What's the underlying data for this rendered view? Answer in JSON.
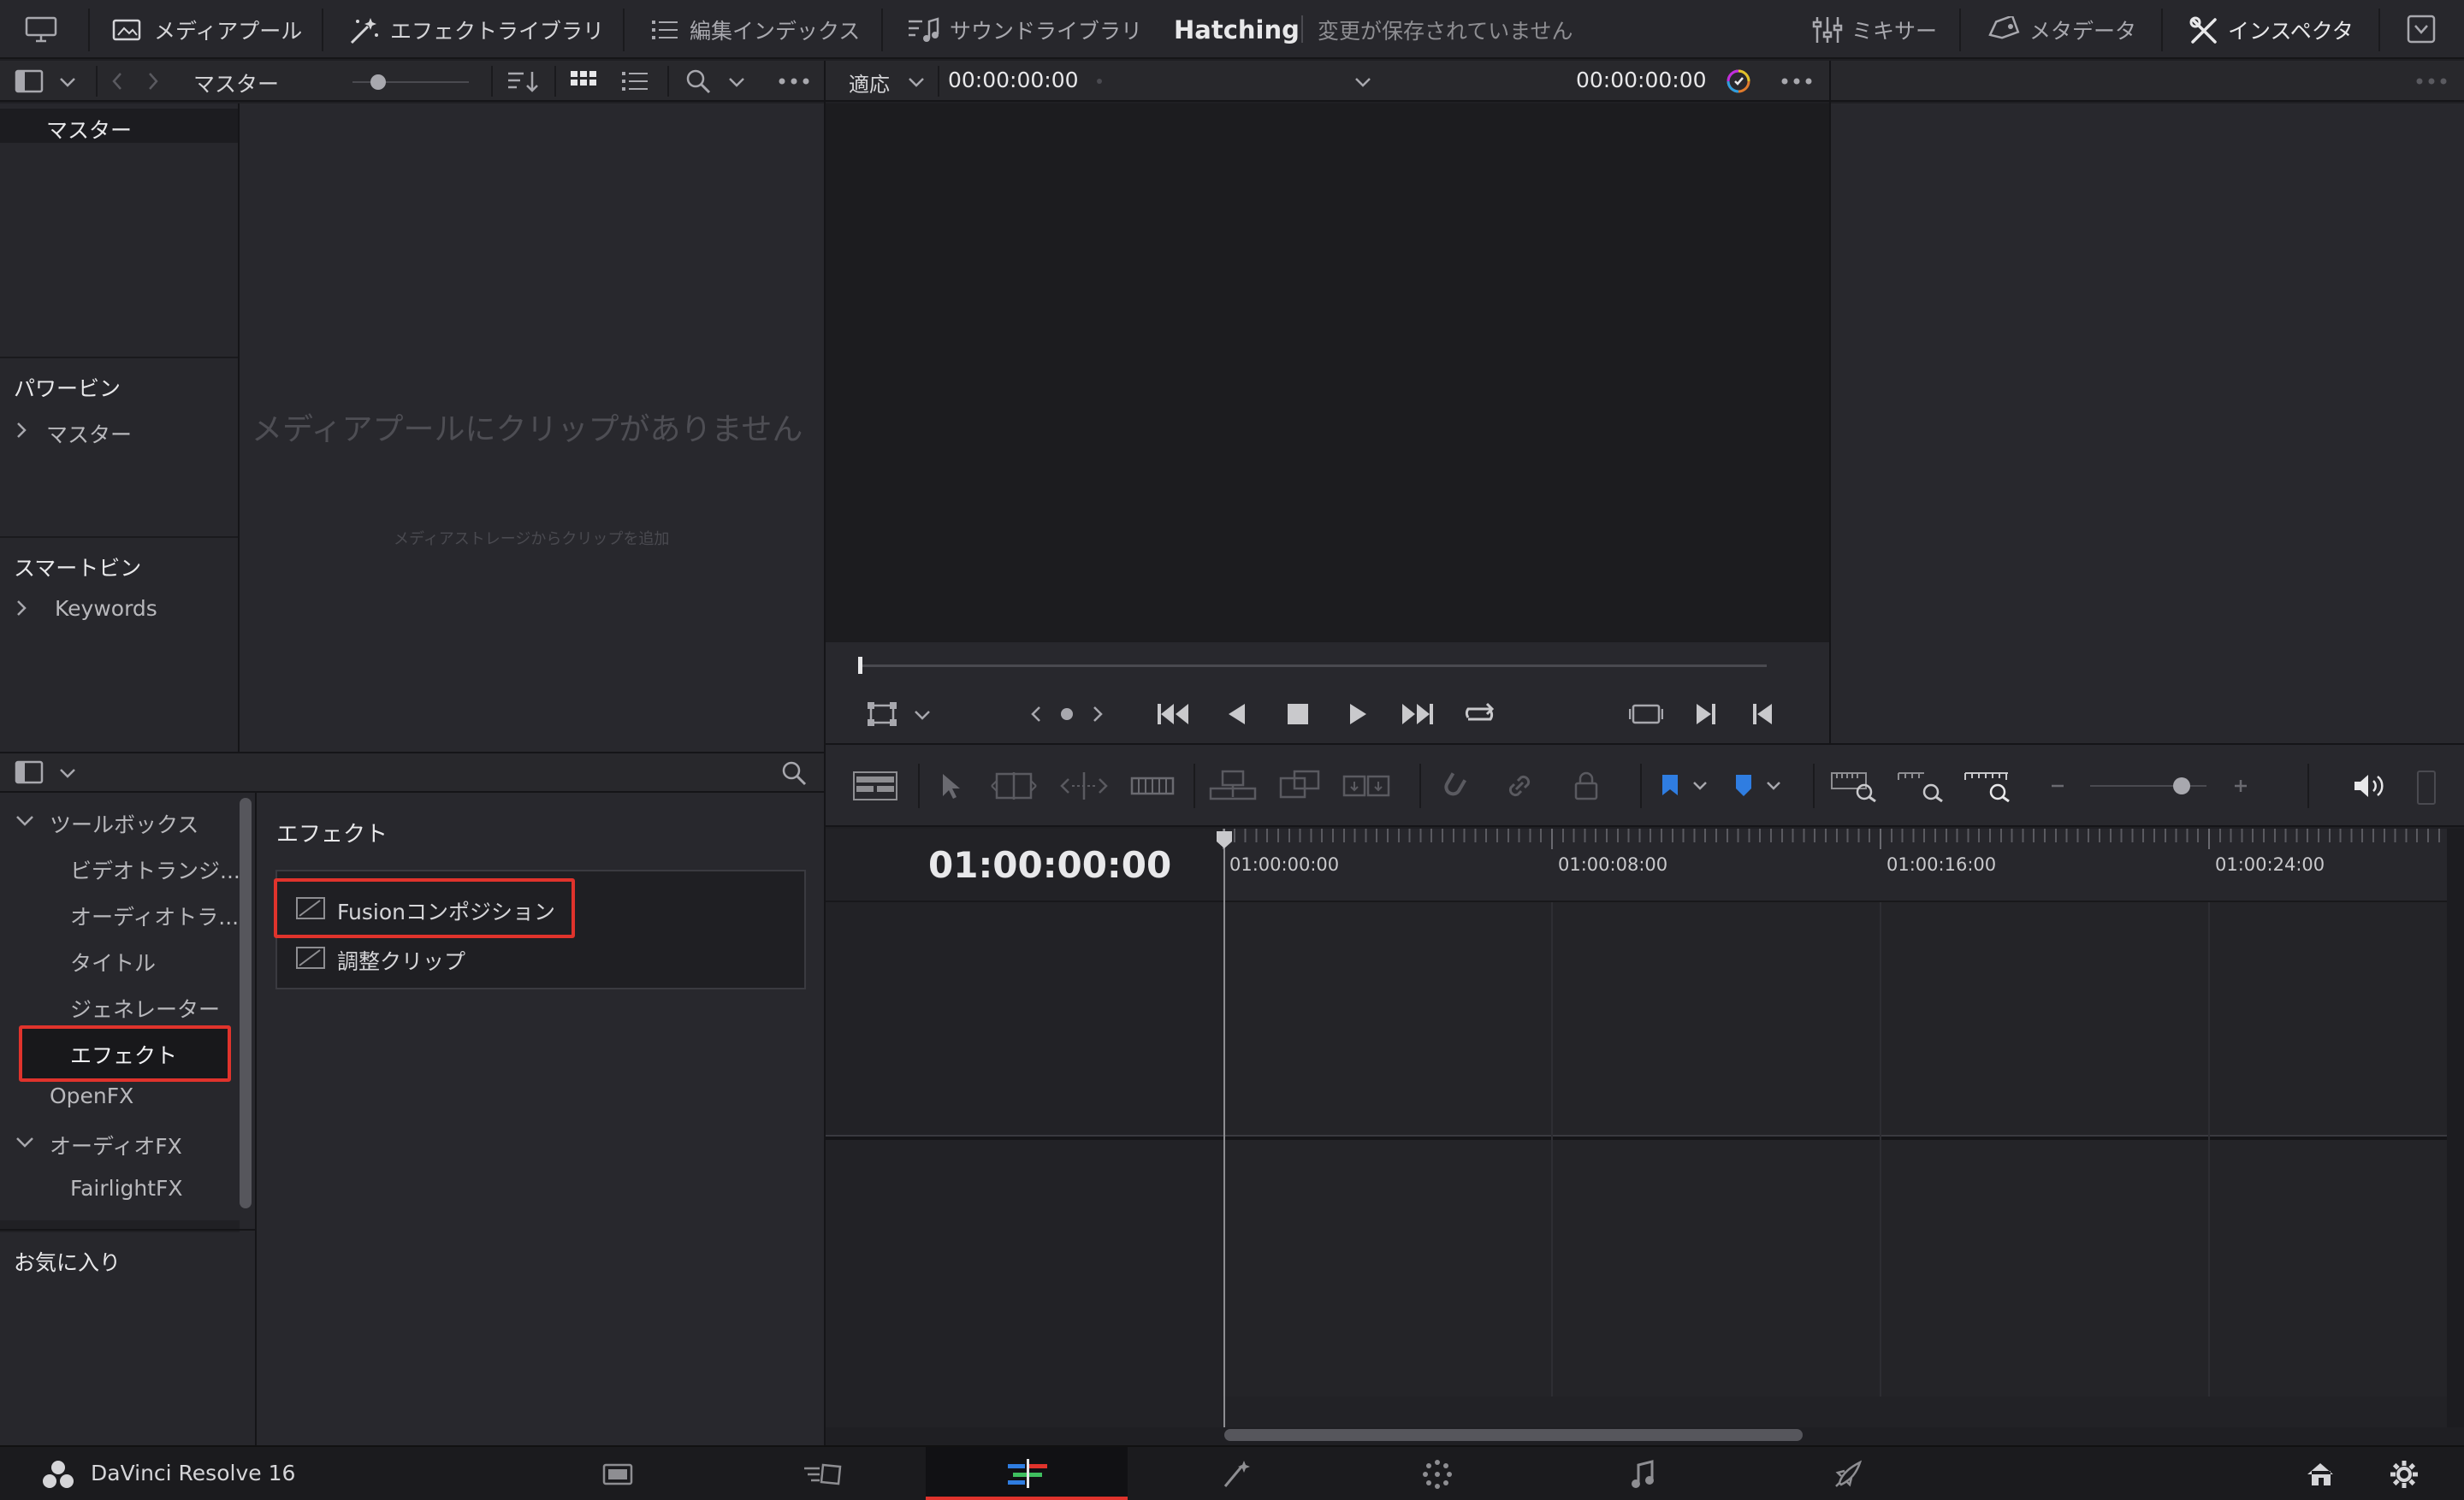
{
  "topbar": {
    "media_pool": "メディアプール",
    "effects_library": "エフェクトライブラリ",
    "edit_index": "編集インデックス",
    "sound_library": "サウンドライブラリ",
    "project_name": "Hatching",
    "save_status": "変更が保存されていません",
    "mixer": "ミキサー",
    "metadata": "メタデータ",
    "inspector": "インスペクタ"
  },
  "media_pool": {
    "bin_title": "マスター",
    "master_label": "マスター",
    "power_bins_header": "パワービン",
    "power_bin_item": "マスター",
    "smart_bins_header": "スマートビン",
    "smart_bin_item": "Keywords",
    "empty_message": "メディアプールにクリップがありません",
    "empty_hint": "メディアストレージからクリップを追加"
  },
  "viewer": {
    "fit_label": "適応",
    "timecode_left": "00:00:00:00",
    "timecode_right": "00:00:00:00"
  },
  "effects": {
    "tree": [
      {
        "label": "ツールボックス",
        "expanded": true
      },
      {
        "label": "ビデオトランジ..."
      },
      {
        "label": "オーディオトラ..."
      },
      {
        "label": "タイトル"
      },
      {
        "label": "ジェネレーター"
      },
      {
        "label": "エフェクト",
        "selected": true
      },
      {
        "label": "OpenFX"
      },
      {
        "label": "オーディオFX",
        "expanded": true
      },
      {
        "label": "FairlightFX"
      }
    ],
    "favorites_header": "お気に入り",
    "list_header": "エフェクト",
    "items": [
      "Fusionコンポジション",
      "調整クリップ"
    ]
  },
  "timeline": {
    "current_timecode": "01:00:00:00",
    "ruler_labels": [
      "01:00:00:00",
      "01:00:08:00",
      "01:00:16:00",
      "01:00:24:00"
    ]
  },
  "bottombar": {
    "app_name": "DaVinci Resolve 16"
  },
  "colors": {
    "highlight_red": "#e0332c",
    "accent_blue": "#2f7de1",
    "active_page_red": "#e0332c"
  }
}
